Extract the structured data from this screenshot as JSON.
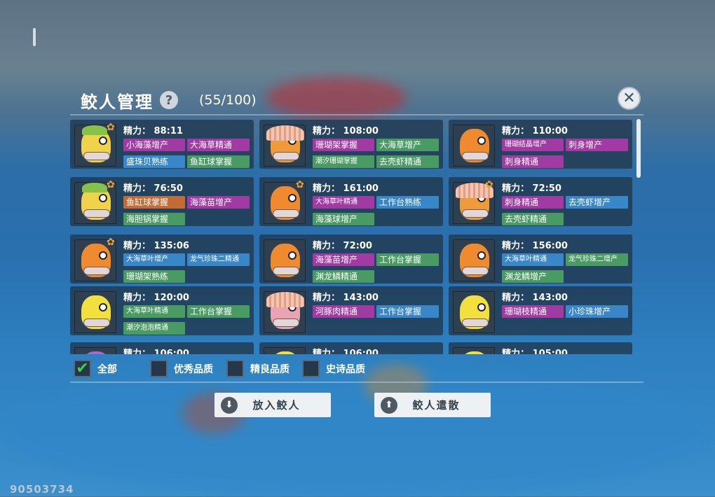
{
  "header": {
    "title": "鲛人管理",
    "help": "?",
    "count": "(55/100)",
    "close": "✕"
  },
  "game_id": "90503734",
  "energy_label": "精力：",
  "cards": [
    {
      "energy": "88:11",
      "star": true,
      "color": "#f0d34a",
      "cap": "leaf",
      "tags": [
        {
          "t": "小海藻增产",
          "c": "purple"
        },
        {
          "t": "大海草精通",
          "c": "purple"
        },
        {
          "t": "盛珠贝熟练",
          "c": "blue"
        },
        {
          "t": "鱼缸球掌握",
          "c": "green"
        }
      ]
    },
    {
      "energy": "108:00",
      "star": false,
      "color": "#ef9b3a",
      "cap": "shell",
      "tags": [
        {
          "t": "珊瑚架掌握",
          "c": "purple"
        },
        {
          "t": "大海草增产",
          "c": "green"
        },
        {
          "t": "潮汐珊瑚掌握",
          "c": "green",
          "s": true
        },
        {
          "t": "去壳虾精通",
          "c": "green"
        }
      ]
    },
    {
      "energy": "110:00",
      "star": false,
      "color": "#f08a2e",
      "cap": "none",
      "tags": [
        {
          "t": "珊瑚结晶增产",
          "c": "purple",
          "s": true
        },
        {
          "t": "刺身增产",
          "c": "purple"
        },
        {
          "t": "刺身精通",
          "c": "purple"
        }
      ]
    },
    {
      "energy": "76:50",
      "star": true,
      "color": "#f0d34a",
      "cap": "leaf",
      "tags": [
        {
          "t": "鱼缸球掌握",
          "c": "orange"
        },
        {
          "t": "海藻苗增产",
          "c": "purple"
        },
        {
          "t": "海胆锅掌握",
          "c": "green"
        }
      ]
    },
    {
      "energy": "161:00",
      "star": true,
      "color": "#f08a2e",
      "cap": "none",
      "tags": [
        {
          "t": "大海草叶精通",
          "c": "purple",
          "s": true
        },
        {
          "t": "工作台熟练",
          "c": "blue"
        },
        {
          "t": "海藻球增产",
          "c": "green"
        }
      ]
    },
    {
      "energy": "72:50",
      "star": true,
      "color": "#ef9b3a",
      "cap": "shell",
      "tags": [
        {
          "t": "刺身精通",
          "c": "purple"
        },
        {
          "t": "去壳虾增产",
          "c": "blue"
        },
        {
          "t": "去壳虾精通",
          "c": "green"
        }
      ]
    },
    {
      "energy": "135:06",
      "star": true,
      "color": "#f08a2e",
      "cap": "none",
      "tags": [
        {
          "t": "大海草叶增产",
          "c": "blue",
          "s": true
        },
        {
          "t": "龙气珍珠二精通",
          "c": "blue",
          "s": true
        },
        {
          "t": "珊瑚架熟练",
          "c": "green"
        }
      ]
    },
    {
      "energy": "72:00",
      "star": false,
      "color": "#f08a2e",
      "cap": "none",
      "tags": [
        {
          "t": "海藻苗增产",
          "c": "purple"
        },
        {
          "t": "工作台掌握",
          "c": "green"
        },
        {
          "t": "渊龙鳞精通",
          "c": "green"
        }
      ]
    },
    {
      "energy": "156:00",
      "star": false,
      "color": "#f08a2e",
      "cap": "none",
      "tags": [
        {
          "t": "大海草叶精通",
          "c": "blue",
          "s": true
        },
        {
          "t": "龙气珍珠二增产",
          "c": "green",
          "s": true
        },
        {
          "t": "渊龙鳞增产",
          "c": "green"
        }
      ]
    },
    {
      "energy": "120:00",
      "star": false,
      "color": "#f2e03c",
      "cap": "none",
      "tags": [
        {
          "t": "大海草叶精通",
          "c": "green",
          "s": true
        },
        {
          "t": "工作台掌握",
          "c": "green"
        },
        {
          "t": "潮汐泡泡精通",
          "c": "green",
          "s": true
        }
      ]
    },
    {
      "energy": "143:00",
      "star": false,
      "color": "#e9a3b3",
      "cap": "shell",
      "tags": [
        {
          "t": "河豚肉精通",
          "c": "purple"
        },
        {
          "t": "工作台掌握",
          "c": "blue"
        }
      ]
    },
    {
      "energy": "143:00",
      "star": false,
      "color": "#f2e03c",
      "cap": "none",
      "tags": [
        {
          "t": "珊瑚枝精通",
          "c": "purple"
        },
        {
          "t": "小珍珠增产",
          "c": "blue"
        }
      ]
    },
    {
      "energy": "106:00",
      "star": false,
      "color": "#a86ad0",
      "cap": "none",
      "tags": []
    },
    {
      "energy": "106:00",
      "star": false,
      "color": "#f2e03c",
      "cap": "none",
      "tags": []
    },
    {
      "energy": "105:00",
      "star": false,
      "color": "#f2e03c",
      "cap": "none",
      "tags": []
    }
  ],
  "filters": [
    {
      "label": "全部",
      "checked": true
    },
    {
      "label": "优秀品质",
      "checked": false
    },
    {
      "label": "精良品质",
      "checked": false
    },
    {
      "label": "史诗品质",
      "checked": false
    }
  ],
  "buttons": {
    "put_in": "放入鲛人",
    "dismiss": "鲛人遣散",
    "put_in_icon": "download-icon",
    "dismiss_icon": "upload-icon"
  }
}
